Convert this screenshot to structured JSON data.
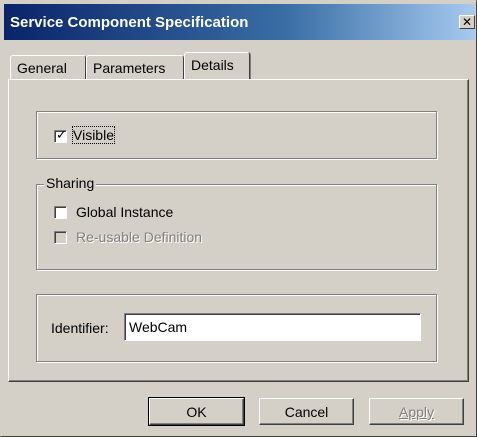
{
  "window": {
    "title": "Service Component Specification",
    "close_glyph": "✕"
  },
  "tabs": [
    {
      "label": "General",
      "active": false
    },
    {
      "label": "Parameters",
      "active": false
    },
    {
      "label": "Details",
      "active": true
    }
  ],
  "visibility": {
    "checkbox_label": "Visible",
    "checked": true,
    "check_glyph": "✓"
  },
  "sharing": {
    "legend": "Sharing",
    "global_instance": {
      "label": "Global Instance",
      "checked": false,
      "enabled": true
    },
    "reusable_definition": {
      "label": "Re-usable Definition",
      "checked": false,
      "enabled": false
    }
  },
  "identifier": {
    "label": "Identifier:",
    "value": "WebCam"
  },
  "buttons": {
    "ok": "OK",
    "cancel": "Cancel",
    "apply": "Apply"
  }
}
